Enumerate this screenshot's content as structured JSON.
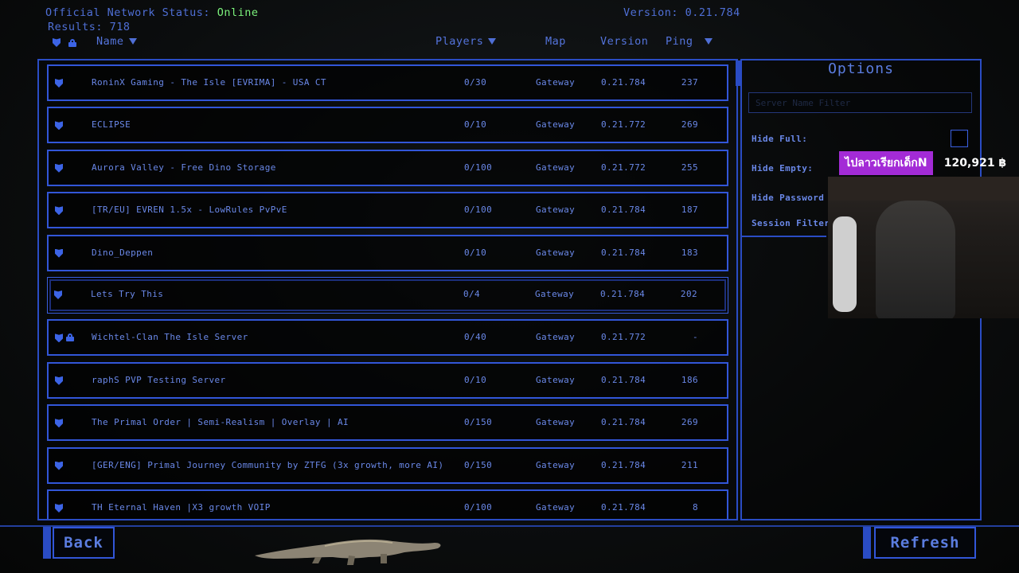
{
  "header": {
    "status_label": "Official Network Status:",
    "status_value": "Online",
    "results_label": "Results:",
    "results_count": "718",
    "version_label": "Version:",
    "version_value": "0.21.784"
  },
  "columns": {
    "name": "Name",
    "players": "Players",
    "map": "Map",
    "version": "Version",
    "ping": "Ping"
  },
  "servers": [
    {
      "name": "RoninX Gaming - The Isle [EVRIMA] - USA CT",
      "players": "0/30",
      "map": "Gateway",
      "version": "0.21.784",
      "ping": "237",
      "locked": false
    },
    {
      "name": "ECLIPSE",
      "players": "0/10",
      "map": "Gateway",
      "version": "0.21.772",
      "ping": "269",
      "locked": false
    },
    {
      "name": "Aurora Valley - Free Dino Storage",
      "players": "0/100",
      "map": "Gateway",
      "version": "0.21.772",
      "ping": "255",
      "locked": false
    },
    {
      "name": "[TR/EU] EVREN 1.5x - LowRules PvPvE",
      "players": "0/100",
      "map": "Gateway",
      "version": "0.21.784",
      "ping": "187",
      "locked": false
    },
    {
      "name": "Dino_Deppen",
      "players": "0/10",
      "map": "Gateway",
      "version": "0.21.784",
      "ping": "183",
      "locked": false
    },
    {
      "name": "Lets Try This",
      "players": "0/4",
      "map": "Gateway",
      "version": "0.21.784",
      "ping": "202",
      "locked": false,
      "selected": true
    },
    {
      "name": "Wichtel-Clan The Isle Server",
      "players": "0/40",
      "map": "Gateway",
      "version": "0.21.772",
      "ping": "-",
      "locked": true
    },
    {
      "name": "raphS PVP Testing Server",
      "players": "0/10",
      "map": "Gateway",
      "version": "0.21.784",
      "ping": "186",
      "locked": false
    },
    {
      "name": "The Primal Order | Semi-Realism | Overlay | AI",
      "players": "0/150",
      "map": "Gateway",
      "version": "0.21.784",
      "ping": "269",
      "locked": false
    },
    {
      "name": "[GER/ENG] Primal Journey Community by ZTFG (3x growth, more AI)",
      "players": "0/150",
      "map": "Gateway",
      "version": "0.21.784",
      "ping": "211",
      "locked": false
    },
    {
      "name": "TH Eternal Haven |X3 growth VOIP",
      "players": "0/100",
      "map": "Gateway",
      "version": "0.21.784",
      "ping": "8",
      "locked": false
    }
  ],
  "options": {
    "title": "Options",
    "filter_placeholder": "Server Name Filter",
    "hide_full": "Hide Full:",
    "hide_empty": "Hide Empty:",
    "hide_password": "Hide Password P",
    "session_filter": "Session Filter:",
    "hide_full_checked": false
  },
  "buttons": {
    "back": "Back",
    "refresh": "Refresh"
  },
  "stream_overlay": {
    "donation_text": "ไปลาวเรียกเด็กN",
    "donation_amount": "120,921 ฿"
  },
  "colors": {
    "accent": "#3256d8",
    "text": "#6a88e8",
    "online": "#7cf27c",
    "donation": "#a32bd6"
  }
}
